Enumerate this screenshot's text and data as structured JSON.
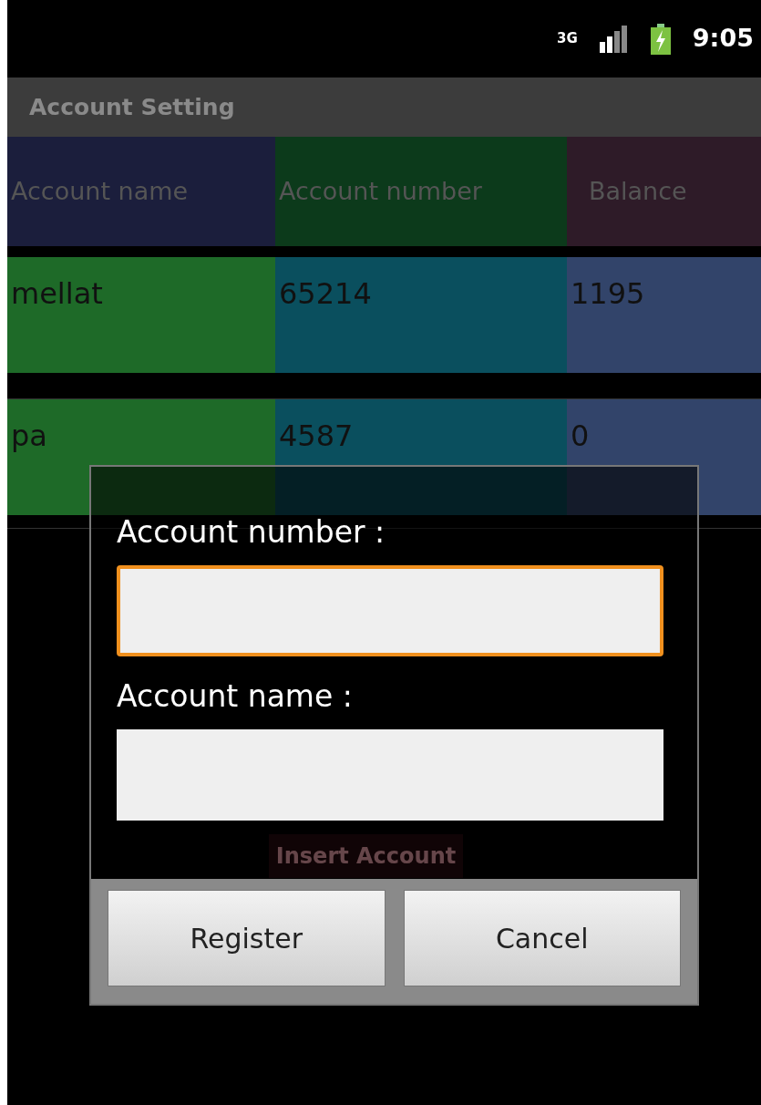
{
  "status_bar": {
    "network": "3G",
    "time": "9:05"
  },
  "title_bar": {
    "title": "Account Setting"
  },
  "table": {
    "columns": [
      {
        "label": "Account name",
        "color": "#1b1e3c"
      },
      {
        "label": "Account number",
        "color": "#0c3a1b"
      },
      {
        "label": "Balance",
        "color": "#2e1b28"
      }
    ],
    "rows": [
      {
        "cells": [
          {
            "text": "mellat",
            "color": "#1e6a28"
          },
          {
            "text": "65214",
            "color": "#0a4f5e"
          },
          {
            "text": "1195",
            "color": "#32446a"
          }
        ]
      },
      {
        "cells": [
          {
            "text": "pa",
            "color": "#1e6a28"
          },
          {
            "text": "4587",
            "color": "#0a4f5e"
          },
          {
            "text": "0",
            "color": "#32446a"
          }
        ]
      }
    ]
  },
  "insert_button": {
    "label": "Insert Account"
  },
  "dialog": {
    "fields": [
      {
        "label": "Account number :",
        "focused": true
      },
      {
        "label": "Account name :",
        "focused": false
      }
    ],
    "buttons": [
      "Register",
      "Cancel"
    ]
  }
}
